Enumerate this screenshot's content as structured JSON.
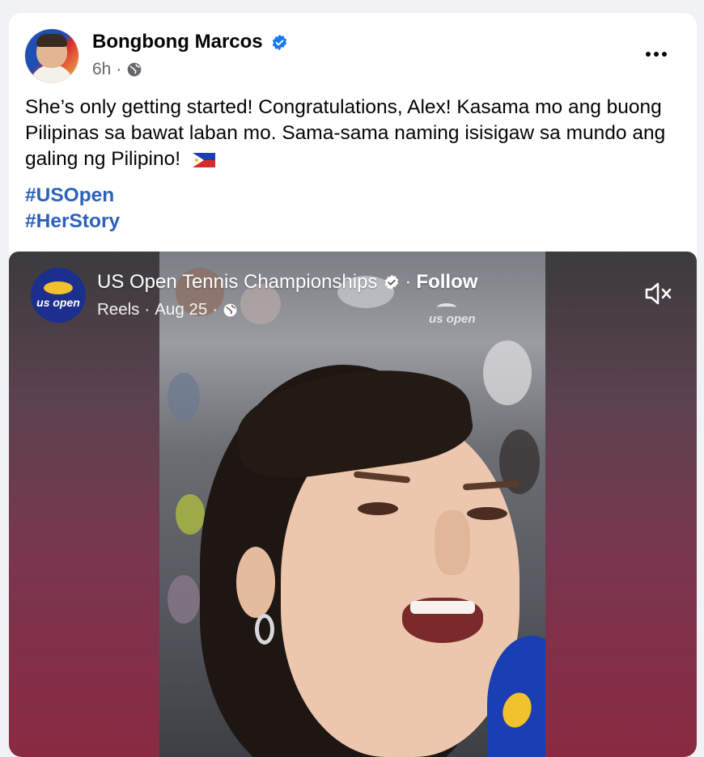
{
  "post": {
    "author": "Bongbong Marcos",
    "time": "6h",
    "text": "She’s only getting started! Congratulations, Alex! Kasama mo ang buong Pilipinas sa bawat laban mo. Sama-sama naming isisigaw sa mundo ang galing ng Pilipino!",
    "hashtags": [
      "#USOpen",
      "#HerStory"
    ]
  },
  "reel": {
    "page_name": "US Open Tennis Championships",
    "follow_label": "Follow",
    "type_label": "Reels",
    "date": "Aug 25",
    "avatar_logo_text": "us open",
    "watermark_text": "us open"
  },
  "colors": {
    "link": "#2d61b9",
    "verified": "#1877f2",
    "meta_text": "#65676b"
  },
  "icons": [
    "verified-badge-icon",
    "globe-icon",
    "more-options-icon",
    "mute-icon",
    "philippines-flag-icon"
  ]
}
